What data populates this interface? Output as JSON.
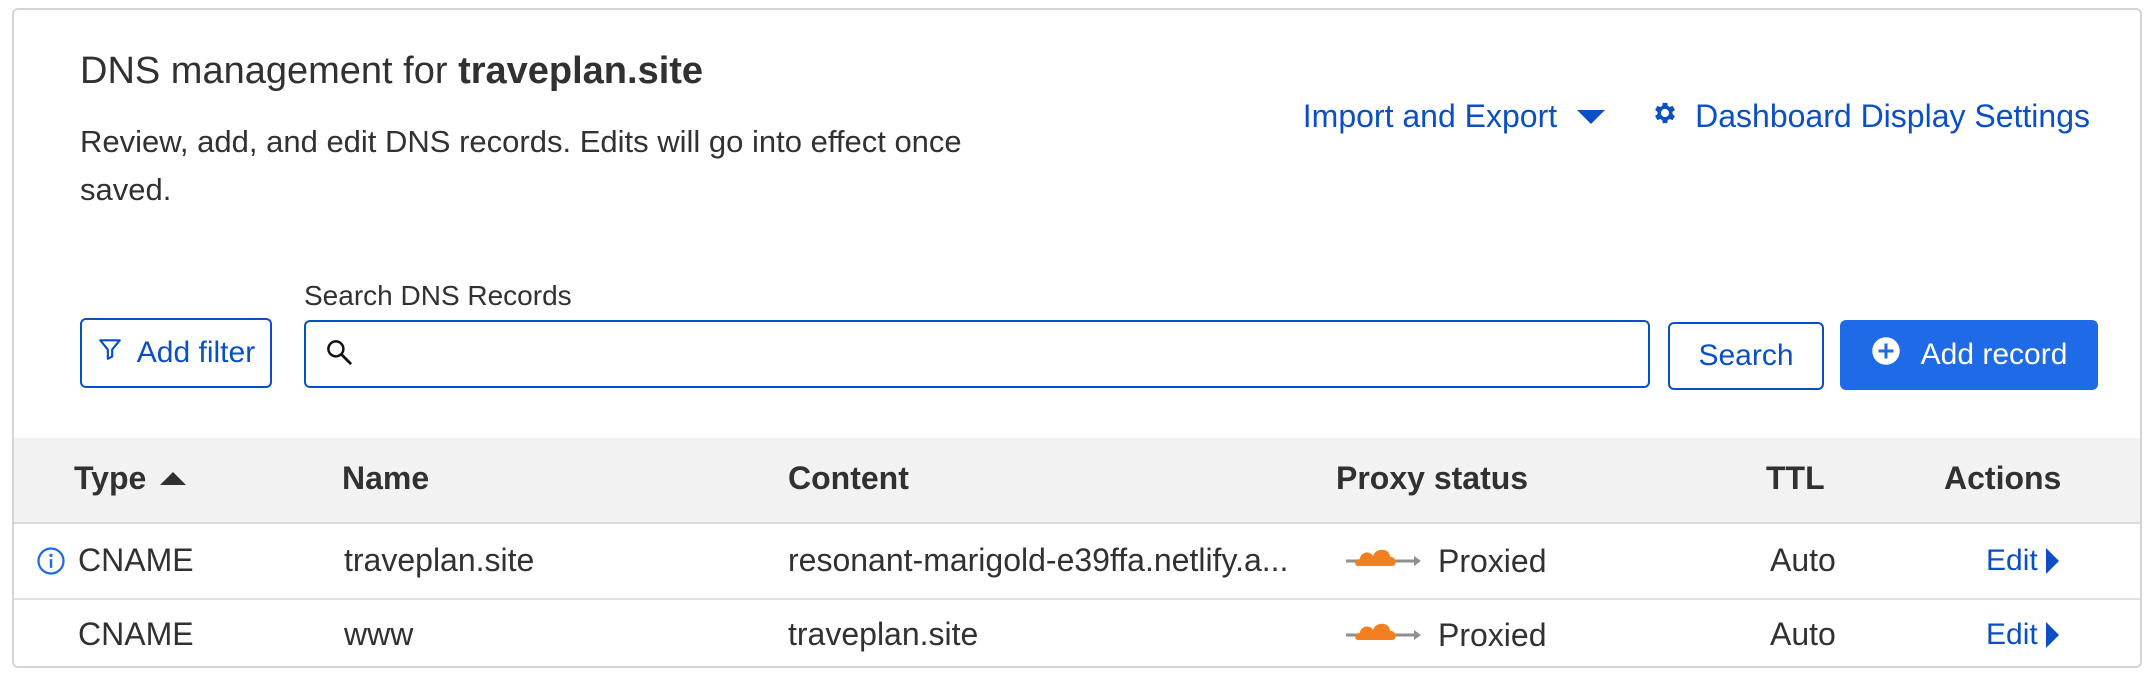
{
  "header": {
    "title_prefix": "DNS management for ",
    "domain": "traveplan.site",
    "description": "Review, add, and edit DNS records. Edits will go into effect once saved.",
    "import_export_label": "Import and Export",
    "display_settings_label": "Dashboard Display Settings"
  },
  "toolbar": {
    "add_filter_label": "Add filter",
    "search_label": "Search DNS Records",
    "search_value": "",
    "search_placeholder": "",
    "search_button_label": "Search",
    "add_record_label": "Add record"
  },
  "table": {
    "columns": [
      "Type",
      "Name",
      "Content",
      "Proxy status",
      "TTL",
      "Actions"
    ],
    "sort_column": "Type",
    "sort_direction": "ascending",
    "rows": [
      {
        "type": "CNAME",
        "name": "traveplan.site",
        "content": "resonant-marigold-e39ffa.netlify.a...",
        "proxy_status": "Proxied",
        "ttl": "Auto",
        "action": "Edit",
        "has_info_icon": true
      },
      {
        "type": "CNAME",
        "name": "www",
        "content": "traveplan.site",
        "proxy_status": "Proxied",
        "ttl": "Auto",
        "action": "Edit",
        "has_info_icon": false
      }
    ]
  },
  "colors": {
    "accent": "#1f6ae6",
    "link": "#0b4fc4",
    "cloud_orange": "#f38020",
    "header_bg": "#f2f2f2"
  },
  "icons": {
    "import_export": "caret-down-icon",
    "settings": "gear-icon",
    "filter": "filter-icon",
    "search": "search-icon",
    "add": "plus-circle-icon",
    "proxy": "orange-cloud-icon",
    "info": "info-icon",
    "edit": "caret-right-icon"
  }
}
